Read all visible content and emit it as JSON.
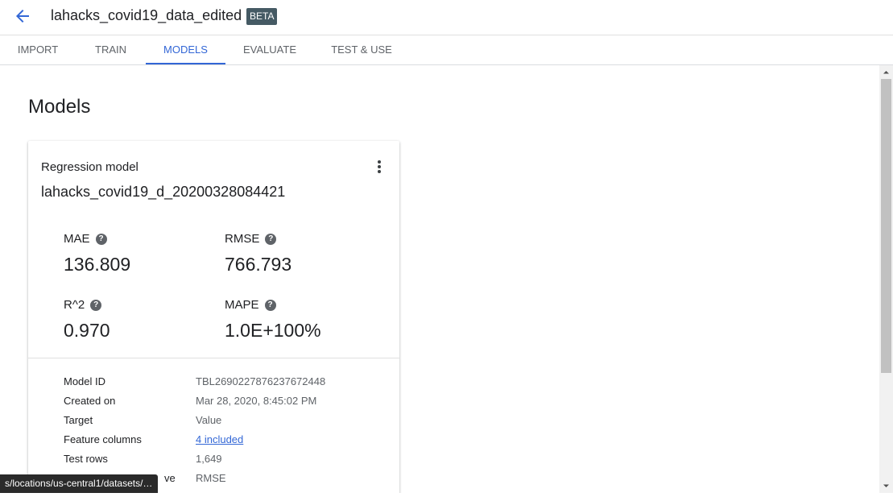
{
  "header": {
    "title": "lahacks_covid19_data_edited",
    "badge": "BETA",
    "back_icon": "arrow-back-icon"
  },
  "tabs": [
    {
      "label": "IMPORT",
      "active": false
    },
    {
      "label": "TRAIN",
      "active": false
    },
    {
      "label": "MODELS",
      "active": true
    },
    {
      "label": "EVALUATE",
      "active": false
    },
    {
      "label": "TEST & USE",
      "active": false
    }
  ],
  "page": {
    "title": "Models"
  },
  "model_card": {
    "kind": "Regression model",
    "name": "lahacks_covid19_d_20200328084421",
    "menu_icon": "more-vert-icon",
    "metrics": [
      {
        "label": "MAE",
        "value": "136.809"
      },
      {
        "label": "RMSE",
        "value": "766.793"
      },
      {
        "label": "R^2",
        "value": "0.970"
      },
      {
        "label": "MAPE",
        "value": "1.0E+100%"
      }
    ],
    "details": [
      {
        "label": "Model ID",
        "value": "TBL2690227876237672448"
      },
      {
        "label": "Created on",
        "value": "Mar 28, 2020, 8:45:02 PM"
      },
      {
        "label": "Target",
        "value": "Value"
      },
      {
        "label": "Feature columns",
        "value": "4 included"
      },
      {
        "label": "Test rows",
        "value": "1,649"
      },
      {
        "label": "ve",
        "value": "RMSE"
      }
    ]
  },
  "status_bar": {
    "url": "s/locations/us-central1/datasets/T..."
  },
  "colors": {
    "accent": "#3367d6",
    "badge_bg": "#455a64",
    "text": "#202124",
    "muted": "#5f6368"
  }
}
